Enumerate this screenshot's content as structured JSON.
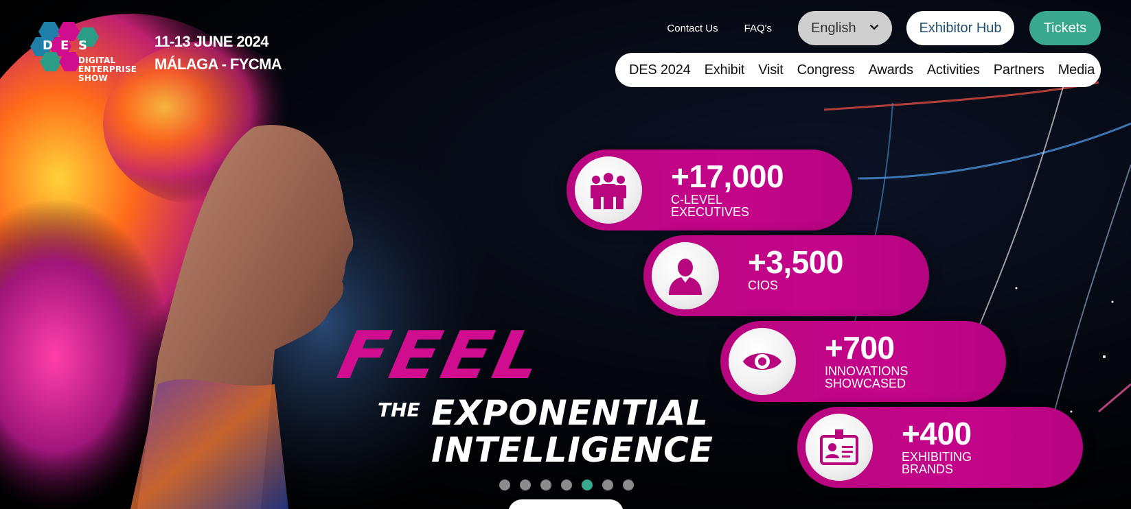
{
  "header": {
    "logo": {
      "letters": [
        "D",
        "E",
        "S"
      ],
      "lines": [
        "DIGITAL",
        "ENTERPRISE",
        "SHOW"
      ]
    },
    "event_dates": "11-13 JUNE 2024",
    "event_location": "MÁLAGA - FYCMA"
  },
  "top_links": {
    "contact": "Contact Us",
    "faqs": "FAQ's",
    "language": "English",
    "exhibitor_hub": "Exhibitor Hub",
    "tickets": "Tickets"
  },
  "main_nav": {
    "items": [
      {
        "label": "DES 2024"
      },
      {
        "label": "Exhibit"
      },
      {
        "label": "Visit"
      },
      {
        "label": "Congress"
      },
      {
        "label": "Awards"
      },
      {
        "label": "Activities"
      },
      {
        "label": "Partners"
      },
      {
        "label": "Media"
      }
    ]
  },
  "stats": [
    {
      "number": "+17,000",
      "label_line1": "C-LEVEL",
      "label_line2": "EXECUTIVES",
      "icon": "group-icon"
    },
    {
      "number": "+3,500",
      "label_line1": "CIOS",
      "label_line2": "",
      "icon": "person-icon"
    },
    {
      "number": "+700",
      "label_line1": "INNOVATIONS",
      "label_line2": "SHOWCASED",
      "icon": "eye-icon"
    },
    {
      "number": "+400",
      "label_line1": "EXHIBITING",
      "label_line2": "BRANDS",
      "icon": "id-badge-icon"
    }
  ],
  "slogan": {
    "feel": "FEEL",
    "the": "THE",
    "line1": "EXPONENTIAL",
    "line2": "INTELLIGENCE"
  },
  "carousel": {
    "total_slides": 7,
    "active_slide": 5
  },
  "colors": {
    "brand_magenta": "#c4058a",
    "accent_teal": "#3aa78f",
    "hub_text": "#1f4c6d"
  }
}
